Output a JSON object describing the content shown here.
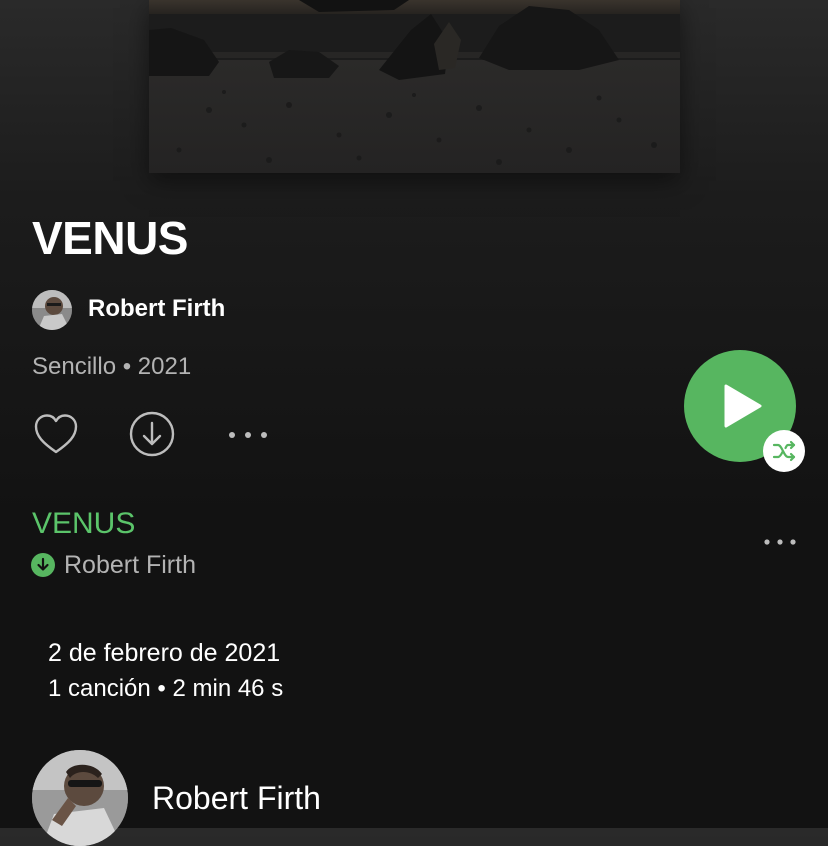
{
  "album": {
    "title": "VENUS",
    "artist": "Robert Firth",
    "meta": "Sencillo • 2021",
    "cover_image": "dark-beach-rocks-photo"
  },
  "actions": {
    "like_icon": "heart-outline-icon",
    "download_icon": "download-circle-icon",
    "more_icon": "more-horizontal-icon",
    "play_icon": "play-icon",
    "shuffle_icon": "shuffle-icon"
  },
  "tracks": [
    {
      "title": "VENUS",
      "artist": "Robert Firth",
      "downloaded": true
    }
  ],
  "details": {
    "release_date": "2 de febrero de 2021",
    "summary": "1 canción • 2 min 46 s"
  },
  "artist_section": {
    "name": "Robert Firth"
  },
  "colors": {
    "accent_green": "#57b660",
    "track_title_green": "#5bc46a",
    "secondary_text": "#b3b3b3",
    "background": "#121212"
  }
}
